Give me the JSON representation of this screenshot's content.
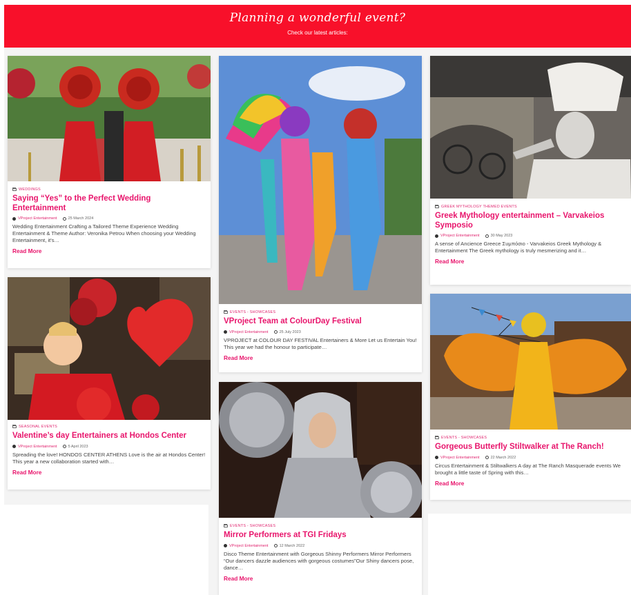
{
  "banner": {
    "title": "Planning a wonderful event?",
    "subtitle": "Check our latest articles:",
    "color": "#f8102a"
  },
  "accent_color": "#e8156c",
  "icons": {
    "category": "folder-icon",
    "author": "user-icon",
    "date": "clock-icon"
  },
  "cards": [
    {
      "category": "WEDDINGS",
      "title": "Saying “Yes” to the Perfect Wedding Entertainment",
      "author": "VProject Entertainment",
      "date": "25 March 2024",
      "excerpt": "Wedding Entertainment Crafting a Tailored Theme Experience Wedding Entertainment & Theme Author: Veronika Petrou When choosing your Wedding Entertainment, it's…",
      "read_more": "Read More",
      "image": "two performers in red gowns with giant red rose headpieces"
    },
    {
      "category": "SEASONAL EVENTS",
      "title": "Valentine’s day Entertainers at Hondos Center",
      "author": "VProject Entertainment",
      "date": "5 April 2023",
      "excerpt": "Spreading the love! HONDOS CENTER ATHENS Love is the air at Hondos Center! This year a new collaboration started with…",
      "read_more": "Read More",
      "image": "performer with red feather headdress and heart balloons"
    },
    {
      "category": "EVENTS - SHOWCASES",
      "title": "VProject Team at ColourDay Festival",
      "author": "VProject Entertainment",
      "date": "25 July 2023",
      "excerpt": "VPROJECT at COLOUR DAY FESTIVAL Entertainers & More Let us Entertain You! This year we had the honour to participate…",
      "read_more": "Read More",
      "image": "rainbow costumed performers at a festival"
    },
    {
      "category": "EVENTS - SHOWCASES",
      "title": "Mirror Performers at TGI Fridays",
      "author": "VProject Entertainment",
      "date": "12 March 2022",
      "excerpt": "Disco Theme Entertainment with Gorgeous Shinny Performers Mirror Performers “Our dancers dazzle audiences with gorgeous costumes”Our Shiny dancers pose, dance…",
      "read_more": "Read More",
      "image": "mirror ball performers"
    },
    {
      "category": "GREEK MYTHOLOGY THEMED EVENTS",
      "title": "Greek Mythology entertainment – Varvakeios Symposio",
      "author": "VProject Entertainment",
      "date": "30 May 2023",
      "excerpt": "A sense of Ancience Greece Συμπόσιο - Varvakeios Greek Mythology & Entertainment The Greek mythology is truly mesmerizing and it…",
      "read_more": "Read More",
      "image": "white living statue performer"
    },
    {
      "category": "EVENTS - SHOWCASES",
      "title": "Gorgeous Butterfly Stiltwalker at The Ranch!",
      "author": "VProject Entertainment",
      "date": "22 March 2022",
      "excerpt": "Circus Entertainment & Stiltwalkers A day at The Ranch Masquerade events We brought a little taste of Spring with this…",
      "read_more": "Read More",
      "image": "butterfly wing stiltwalker in yellow"
    }
  ]
}
